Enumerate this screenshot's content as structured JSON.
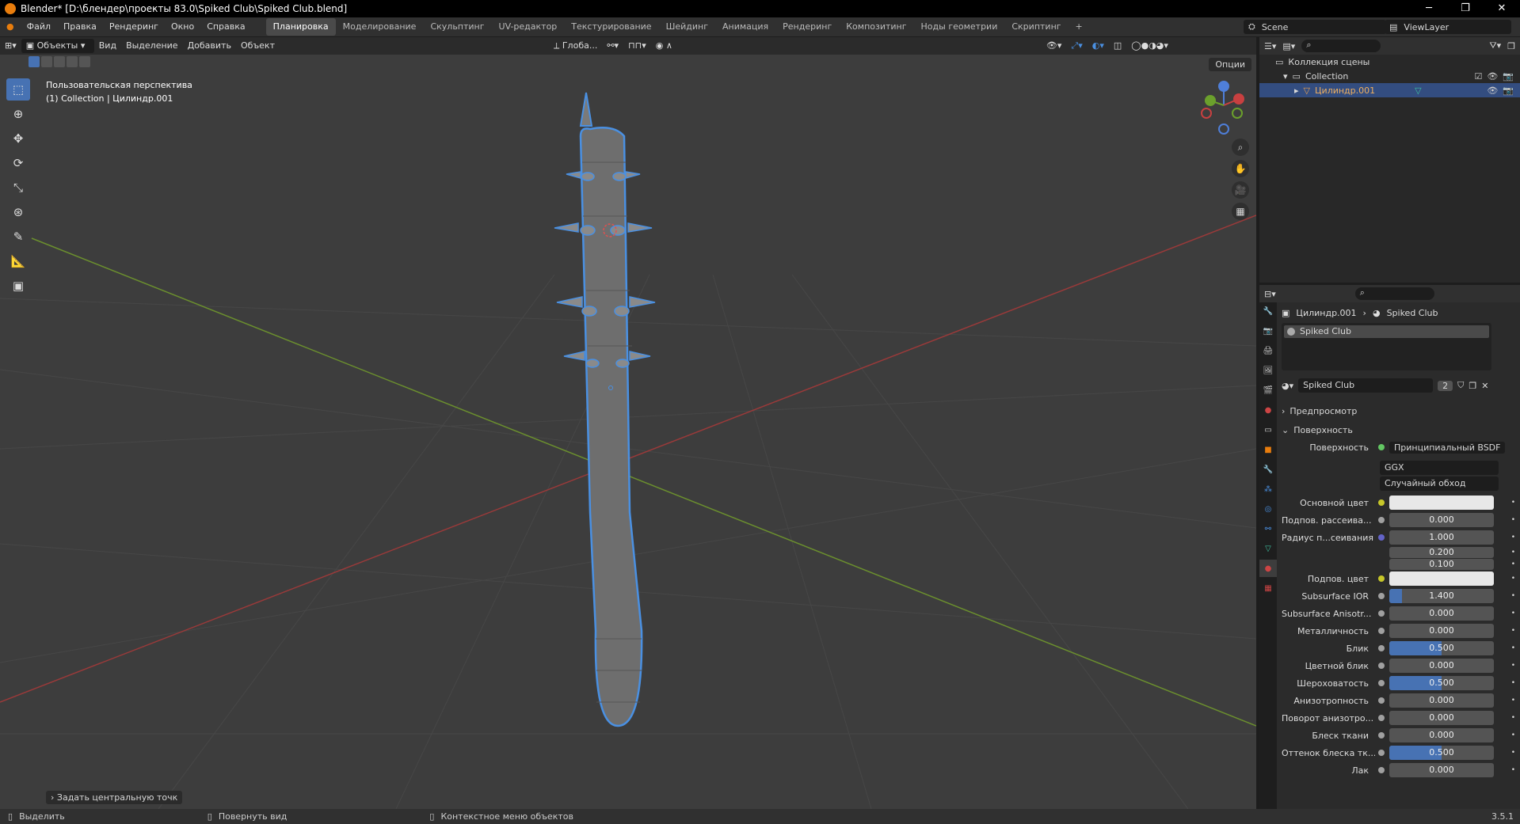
{
  "titlebar": {
    "title": "Blender* [D:\\блендер\\проекты 83.0\\Spiked Club\\Spiked Club.blend]"
  },
  "menu": [
    "Файл",
    "Правка",
    "Рендеринг",
    "Окно",
    "Справка"
  ],
  "workspaces": [
    "Планировка",
    "Моделирование",
    "Скульптинг",
    "UV-редактор",
    "Текстурирование",
    "Шейдинг",
    "Анимация",
    "Рендеринг",
    "Композитинг",
    "Ноды геометрии",
    "Скриптинг"
  ],
  "active_workspace": "Планировка",
  "scene": "Scene",
  "view_layer": "ViewLayer",
  "viewport": {
    "mode": "Объекты",
    "menus": [
      "Вид",
      "Выделение",
      "Добавить",
      "Объект"
    ],
    "orientation": "Глоба...",
    "options": "Опции",
    "info_line1": "Пользовательская перспектива",
    "info_line2": "(1) Collection | Цилиндр.001",
    "last_operator": "Задать центральную точк"
  },
  "outliner": {
    "scene_collection": "Коллекция сцены",
    "collection": "Collection",
    "object": "Цилиндр.001"
  },
  "properties": {
    "object": "Цилиндр.001",
    "material": "Spiked Club",
    "slot": "Spiked Club",
    "users": "2",
    "panel_preview": "Предпросмотр",
    "panel_surface": "Поверхность",
    "surface_label": "Поверхность",
    "surface_value": "Принципиальный BSDF",
    "distribution": "GGX",
    "subsurface_method": "Случайный обход",
    "rows": [
      {
        "label": "Основной цвет",
        "value": "",
        "kind": "white",
        "dot": "y"
      },
      {
        "label": "Подпов. рассеива...",
        "value": "0.000",
        "kind": "num",
        "dot": "n"
      },
      {
        "label": "Радиус п...сеивания",
        "value": "1.000",
        "kind": "num",
        "dot": "b"
      },
      {
        "label": "",
        "value": "0.200",
        "kind": "num",
        "dot": ""
      },
      {
        "label": "",
        "value": "0.100",
        "kind": "num",
        "dot": ""
      },
      {
        "label": "Подпов. цвет",
        "value": "",
        "kind": "white",
        "dot": "y"
      },
      {
        "label": "Subsurface IOR",
        "value": "1.400",
        "kind": "num",
        "dot": "n",
        "fill": 0.12
      },
      {
        "label": "Subsurface Anisotr...",
        "value": "0.000",
        "kind": "num",
        "dot": "n"
      },
      {
        "label": "Металличность",
        "value": "0.000",
        "kind": "num",
        "dot": "n"
      },
      {
        "label": "Блик",
        "value": "0.500",
        "kind": "num",
        "dot": "n",
        "fill": 0.5
      },
      {
        "label": "Цветной блик",
        "value": "0.000",
        "kind": "num",
        "dot": "n"
      },
      {
        "label": "Шероховатость",
        "value": "0.500",
        "kind": "num",
        "dot": "n",
        "fill": 0.5
      },
      {
        "label": "Анизотропность",
        "value": "0.000",
        "kind": "num",
        "dot": "n"
      },
      {
        "label": "Поворот анизотро...",
        "value": "0.000",
        "kind": "num",
        "dot": "n"
      },
      {
        "label": "Блеск ткани",
        "value": "0.000",
        "kind": "num",
        "dot": "n"
      },
      {
        "label": "Оттенок блеска тк...",
        "value": "0.500",
        "kind": "num",
        "dot": "n",
        "fill": 0.5
      },
      {
        "label": "Лак",
        "value": "0.000",
        "kind": "num",
        "dot": "n"
      }
    ]
  },
  "statusbar": {
    "select": "Выделить",
    "rotate": "Повернуть вид",
    "context": "Контекстное меню объектов",
    "version": "3.5.1"
  }
}
